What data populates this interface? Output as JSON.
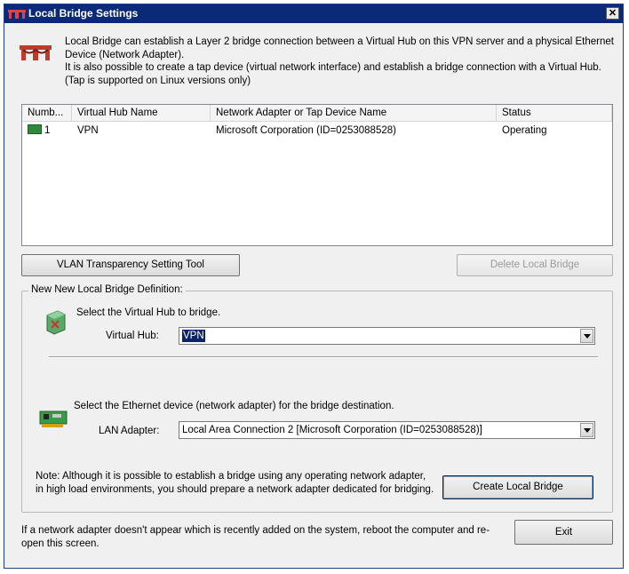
{
  "window": {
    "title": "Local Bridge Settings",
    "close_glyph": "✕"
  },
  "description": {
    "line1": "Local Bridge can establish a Layer 2 bridge connection between a Virtual Hub on this VPN server and a physical Ethernet Device (Network Adapter).",
    "line2": "It is also possible to create a tap device (virtual network interface) and establish a bridge connection with a Virtual Hub. (Tap is supported on Linux versions only)"
  },
  "table": {
    "columns": [
      "Numb...",
      "Virtual Hub Name",
      "Network Adapter or Tap Device Name",
      "Status"
    ],
    "rows": [
      {
        "number": "1",
        "hub": "VPN",
        "adapter": "Microsoft Corporation (ID=0253088528)",
        "status": "Operating"
      }
    ]
  },
  "buttons": {
    "vlan_tool": "VLAN Transparency Setting Tool",
    "delete_bridge": "Delete Local Bridge",
    "create_bridge": "Create Local Bridge",
    "exit": "Exit"
  },
  "new_bridge": {
    "group_label": "New New Local Bridge Definition:",
    "hub_instruction": "Select the Virtual Hub to bridge.",
    "hub_label": "Virtual Hub:",
    "hub_value": "VPN",
    "adapter_instruction": "Select the Ethernet device (network adapter) for the bridge destination.",
    "adapter_label": "LAN Adapter:",
    "adapter_value": "Local Area Connection 2 [Microsoft Corporation (ID=0253088528)]",
    "note": "Note: Although it is possible to establish a bridge using any operating network adapter, in high load environments, you should prepare a network adapter dedicated for bridging."
  },
  "footer_text": "If a network adapter doesn't appear which is recently added on the system, reboot the computer and re-open this screen.",
  "icons": {
    "app": "bridge-icon",
    "row": "network-adapter-icon",
    "hub": "virtual-hub-icon",
    "nic": "network-card-icon"
  },
  "colors": {
    "titlebar": "#0a2a78",
    "selection": "#0a246a",
    "status_icon": "#2d8a3a"
  }
}
